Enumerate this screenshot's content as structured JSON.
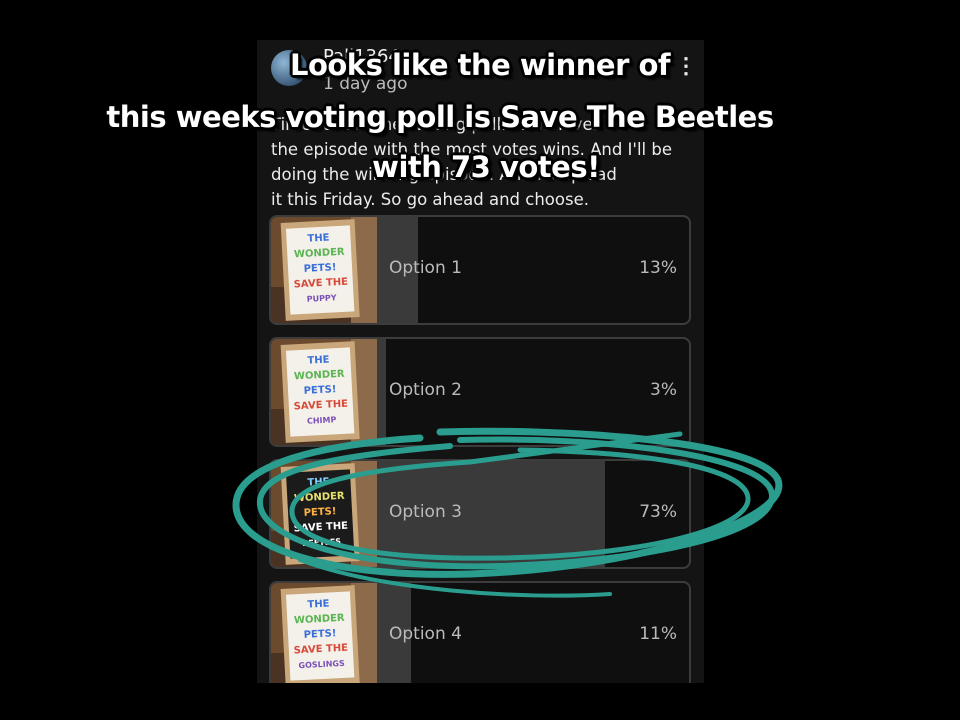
{
  "post": {
    "username": "Pali1364",
    "time": "1 day ago",
    "menu_icon": "more-vert-icon",
    "body_lines": [
      "Time for another voting poll. Whichever",
      "the episode with the most votes wins. And I'll be",
      "doing the winning episode. And I'll upload",
      "it this Friday. So go ahead and choose."
    ]
  },
  "poll": {
    "options": [
      {
        "label": "Option 1",
        "percent": "13%",
        "fill": 0.13,
        "thumb_text": [
          "THE",
          "WONDER",
          "PETS!",
          "SAVE THE",
          "PUPPY"
        ],
        "board_color": "#f4f1ea"
      },
      {
        "label": "Option 2",
        "percent": "3%",
        "fill": 0.03,
        "thumb_text": [
          "THE",
          "WONDER",
          "PETS!",
          "SAVE THE",
          "CHIMP"
        ],
        "board_color": "#f4f1ea"
      },
      {
        "label": "Option 3",
        "percent": "73%",
        "fill": 0.73,
        "thumb_text": [
          "THE",
          "WONDER",
          "PETS!",
          "SAVE THE",
          "BEETLES"
        ],
        "board_color": "#1b1b1b"
      },
      {
        "label": "Option 4",
        "percent": "11%",
        "fill": 0.11,
        "thumb_text": [
          "THE",
          "WONDER",
          "PETS!",
          "SAVE THE",
          "GOSLINGS"
        ],
        "board_color": "#f4f1ea"
      }
    ]
  },
  "caption": {
    "line1": "Looks like the winner of",
    "line2": "this weeks voting poll is Save The Beetles",
    "line3": "with 73 votes!"
  },
  "colors": {
    "highlight_scribble": "#2a9d8f",
    "fill_bar": "#3a3a3a",
    "option_border": "#3c3c3c"
  }
}
